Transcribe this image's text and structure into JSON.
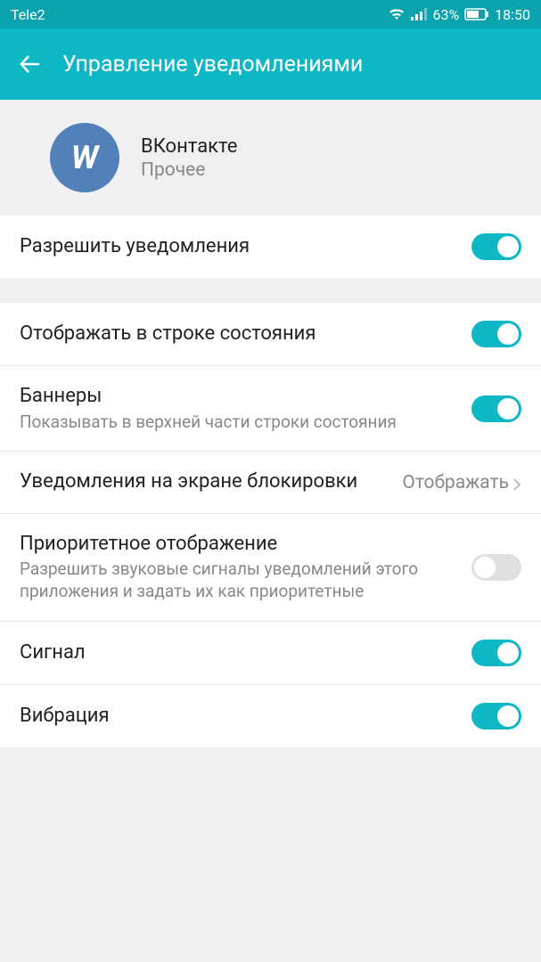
{
  "statusBar": {
    "carrier": "Tele2",
    "battery": "63%",
    "time": "18:50"
  },
  "header": {
    "title": "Управление уведомлениями"
  },
  "app": {
    "name": "ВКонтакте",
    "category": "Прочее",
    "iconText": "W"
  },
  "settings": {
    "allowNotifications": {
      "title": "Разрешить уведомления",
      "enabled": true
    },
    "showInStatusBar": {
      "title": "Отображать в строке состояния",
      "enabled": true
    },
    "banners": {
      "title": "Баннеры",
      "subtitle": "Показывать в верхней части строки состояния",
      "enabled": true
    },
    "lockScreen": {
      "title": "Уведомления на экране блокировки",
      "value": "Отображать"
    },
    "priority": {
      "title": "Приоритетное отображение",
      "subtitle": "Разрешить звуковые сигналы уведомлений этого приложения и задать их как приоритетные",
      "enabled": false
    },
    "sound": {
      "title": "Сигнал",
      "enabled": true
    },
    "vibration": {
      "title": "Вибрация",
      "enabled": true
    }
  }
}
